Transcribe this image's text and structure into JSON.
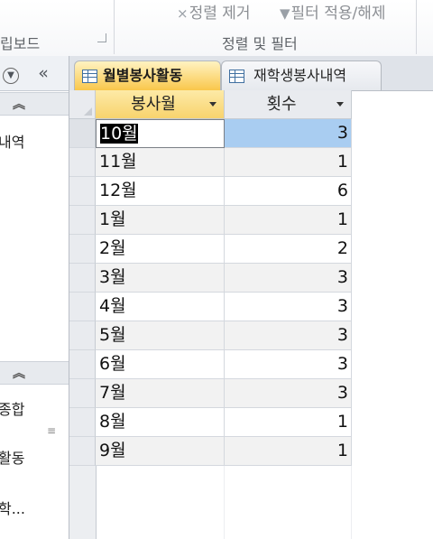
{
  "ribbon": {
    "commands": {
      "remove_sort": "정렬 제거",
      "toggle_filter": "필터 적용/해제"
    },
    "groups": {
      "clipboard": "립보드",
      "sort_filter": "정렬 및 필터"
    }
  },
  "nav": {
    "collapse_glyph": "«",
    "sections": [
      {
        "items": [
          "내역"
        ]
      },
      {
        "items": [
          "종합",
          "활동",
          "학..."
        ]
      }
    ]
  },
  "tabs": [
    {
      "label": "월별봉사활동",
      "active": true
    },
    {
      "label": "재학생봉사내역",
      "active": false
    }
  ],
  "table": {
    "columns": [
      "봉사월",
      "횟수"
    ],
    "rows": [
      {
        "month": "10월",
        "count": "3"
      },
      {
        "month": "11월",
        "count": "1"
      },
      {
        "month": "12월",
        "count": "6"
      },
      {
        "month": "1월",
        "count": "1"
      },
      {
        "month": "2월",
        "count": "2"
      },
      {
        "month": "3월",
        "count": "3"
      },
      {
        "month": "4월",
        "count": "3"
      },
      {
        "month": "5월",
        "count": "3"
      },
      {
        "month": "6월",
        "count": "3"
      },
      {
        "month": "7월",
        "count": "3"
      },
      {
        "month": "8월",
        "count": "1"
      },
      {
        "month": "9월",
        "count": "1"
      }
    ],
    "current_row": 0
  },
  "colors": {
    "active_tab": "#f9c74b",
    "selected_cell": "#a9cdf1",
    "header_selected": "#f8d36d"
  }
}
